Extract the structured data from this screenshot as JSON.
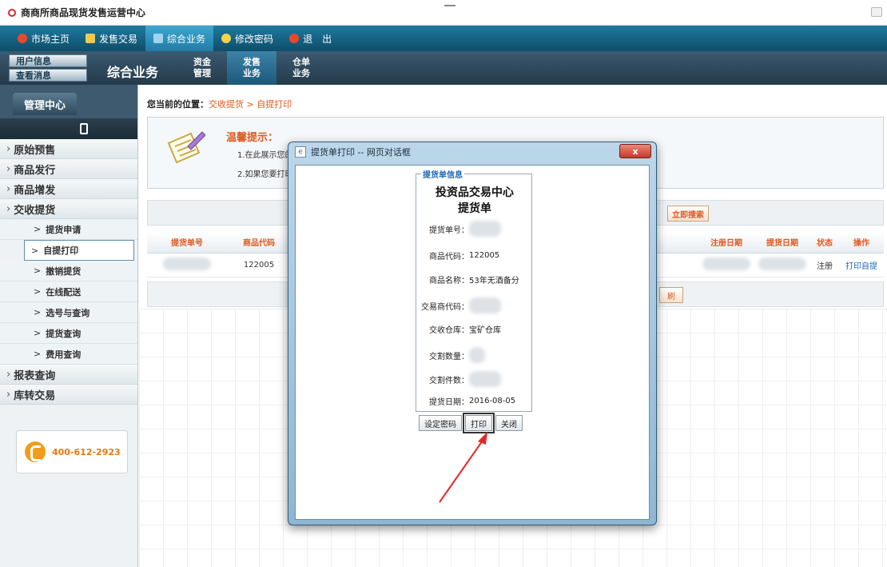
{
  "window": {
    "title": "商商所商品现货发售运营中心"
  },
  "topnav": {
    "items": [
      {
        "label": "市场主页",
        "icon": "home-icon",
        "color": "#e8492b"
      },
      {
        "label": "发售交易",
        "icon": "yen-icon",
        "color": "#f2c94c"
      },
      {
        "label": "综合业务",
        "icon": "monitor-icon",
        "color": "#9fd3ec"
      },
      {
        "label": "修改密码",
        "icon": "key-icon",
        "color": "#f6d14a"
      },
      {
        "label": "退　出",
        "icon": "power-icon",
        "color": "#e8492b"
      }
    ]
  },
  "subbar": {
    "user_info": "用户信息",
    "view_messages": "查看消息",
    "section_title": "综合业务",
    "tabs": [
      {
        "line1": "资金",
        "line2": "管理"
      },
      {
        "line1": "发售",
        "line2": "业务"
      },
      {
        "line1": "仓单",
        "line2": "业务"
      }
    ]
  },
  "sidebar": {
    "header_tab": "管理中心",
    "menu": [
      {
        "label": "原始预售"
      },
      {
        "label": "商品发行"
      },
      {
        "label": "商品增发"
      },
      {
        "label": "交收提货"
      }
    ],
    "sub_items": [
      {
        "label": "提货申请"
      },
      {
        "label": "自提打印"
      },
      {
        "label": "撤销提货"
      },
      {
        "label": "在线配送"
      },
      {
        "label": "选号与查询"
      },
      {
        "label": "提货查询"
      },
      {
        "label": "费用查询"
      }
    ],
    "menu_bottom": [
      {
        "label": "报表查询"
      },
      {
        "label": "库转交易"
      }
    ],
    "phone": "400-612-2923"
  },
  "main": {
    "breadcrumb_label": "您当前的位置：",
    "breadcrumb_path": "交收提货 > 自提打印",
    "tip_title": "温馨提示：",
    "tip_lines": [
      "1.在此展示您的",
      "2.如果您要打印"
    ],
    "search_button": "立即搜索",
    "columns": [
      "提货单号",
      "商品代码",
      "",
      "",
      "",
      "",
      "",
      "",
      "",
      "注册日期",
      "提货日期",
      "状态",
      "操作"
    ],
    "row": {
      "product_code": "122005",
      "status": "注册",
      "action": "打印自提"
    },
    "footer_button": "刷"
  },
  "dialog": {
    "title": "提货单打印 -- 网页对话框",
    "close": "x",
    "legend": "提货单信息",
    "heading1": "投资品交易中心",
    "heading2": "提货单",
    "fields": [
      {
        "label": "提货单号：",
        "value": ""
      },
      {
        "label": "商品代码：",
        "value": "122005"
      },
      {
        "label": "商品名称：",
        "value": "53年无酒备分"
      },
      {
        "label": "交易商代码：",
        "value": ""
      },
      {
        "label": "交收仓库：",
        "value": "宝矿仓库"
      },
      {
        "label": "交割数量：",
        "value": ""
      },
      {
        "label": "交割件数：",
        "value": ""
      },
      {
        "label": "提货日期：",
        "value": "2016-08-05"
      }
    ],
    "buttons": {
      "set_password": "设定密码",
      "print": "打印",
      "close": "关闭"
    }
  }
}
